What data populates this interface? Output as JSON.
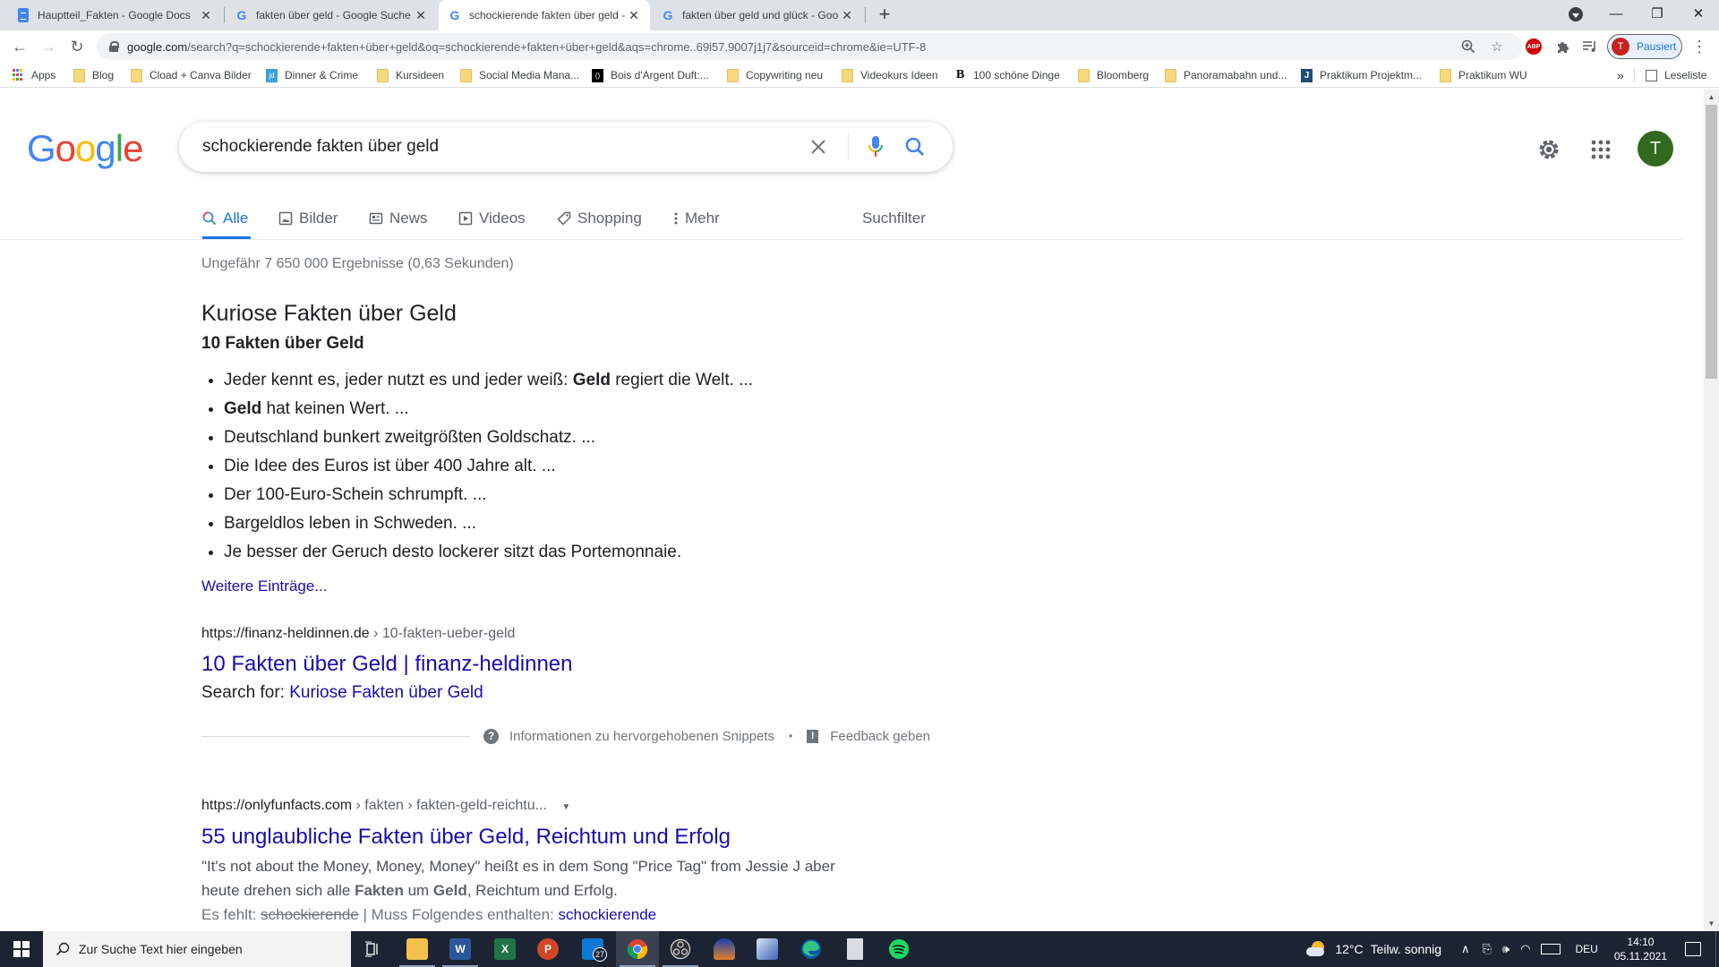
{
  "browser": {
    "tabs": [
      {
        "title": "Hauptteil_Fakten - Google Docs",
        "favicon": "google-docs-icon",
        "active": false
      },
      {
        "title": "fakten über geld - Google Suche",
        "favicon": "google-g-icon",
        "active": false
      },
      {
        "title": "schockierende fakten über geld -",
        "favicon": "google-g-icon",
        "active": true
      },
      {
        "title": "fakten über geld und glück - Goo",
        "favicon": "google-g-icon",
        "active": false
      }
    ],
    "new_tab_label": "+",
    "close_tab_glyph": "✕",
    "window_controls": {
      "minimize": "—",
      "restore": "❐",
      "close": "✕"
    },
    "address": {
      "host": "google.com",
      "path": "/search?q=schockierende+fakten+über+geld&oq=schockierende+fakten+über+geld&aqs=chrome..69i57.9007j1j7&sourceid=chrome&ie=UTF-8"
    },
    "profile": {
      "initial": "T",
      "label": "Pausiert"
    },
    "extensions": {
      "abp_label": "ABP"
    },
    "bookmarks": [
      {
        "label": "Apps",
        "icon": "apps-grid-icon"
      },
      {
        "label": "Blog",
        "icon": "folder-icon"
      },
      {
        "label": "Cload + Canva Bilder",
        "icon": "folder-icon"
      },
      {
        "label": "Dinner & Crime",
        "icon": "jd-site-icon"
      },
      {
        "label": "Kursideen",
        "icon": "folder-icon"
      },
      {
        "label": "Social Media Mana...",
        "icon": "folder-icon"
      },
      {
        "label": "Bois d'Argent Duft:...",
        "icon": "bois-site-icon"
      },
      {
        "label": "Copywriting neu",
        "icon": "folder-icon"
      },
      {
        "label": "Videokurs Ideen",
        "icon": "folder-icon"
      },
      {
        "label": "100 schöne Dinge",
        "icon": "b-site-icon"
      },
      {
        "label": "Bloomberg",
        "icon": "folder-icon"
      },
      {
        "label": "Panoramabahn und...",
        "icon": "folder-icon"
      },
      {
        "label": "Praktikum Projektm...",
        "icon": "j-site-icon"
      },
      {
        "label": "Praktikum WU",
        "icon": "folder-icon"
      }
    ],
    "bookmarks_overflow": "»",
    "reading_list_label": "Leseliste"
  },
  "google": {
    "logo_letters": [
      "G",
      "o",
      "o",
      "g",
      "l",
      "e"
    ],
    "logo_colors": [
      "#4285f4",
      "#ea4335",
      "#fbbc05",
      "#4285f4",
      "#34a853",
      "#ea4335"
    ],
    "query": "schockierende fakten über geld",
    "avatar_initial": "T",
    "nav_tabs": [
      {
        "label": "Alle",
        "icon": "search-icon",
        "active": true
      },
      {
        "label": "Bilder",
        "icon": "image-icon",
        "active": false
      },
      {
        "label": "News",
        "icon": "news-icon",
        "active": false
      },
      {
        "label": "Videos",
        "icon": "video-icon",
        "active": false
      },
      {
        "label": "Shopping",
        "icon": "tag-icon",
        "active": false
      },
      {
        "label": "Mehr",
        "icon": "more-vert-icon",
        "active": false
      }
    ],
    "search_tools_label": "Suchfilter",
    "result_stats": "Ungefähr 7 650 000 Ergebnisse (0,63 Sekunden)",
    "featured_snippet": {
      "title": "Kuriose Fakten über Geld",
      "subtitle": "10 Fakten über Geld",
      "items": [
        {
          "pre": "Jeder kennt es, jeder nutzt es und jeder weiß: ",
          "bold": "Geld",
          "post": " regiert die Welt. ..."
        },
        {
          "pre": "",
          "bold": "Geld",
          "post": " hat keinen Wert. ..."
        },
        {
          "pre": "Deutschland bunkert zweitgrößten Goldschatz. ...",
          "bold": "",
          "post": ""
        },
        {
          "pre": "Die Idee des Euros ist über 400 Jahre alt. ...",
          "bold": "",
          "post": ""
        },
        {
          "pre": "Der 100-Euro-Schein schrumpft. ...",
          "bold": "",
          "post": ""
        },
        {
          "pre": "Bargeldlos leben in Schweden. ...",
          "bold": "",
          "post": ""
        },
        {
          "pre": "Je besser der Geruch desto lockerer sitzt das Portemonnaie.",
          "bold": "",
          "post": ""
        }
      ],
      "more_label": "Weitere Einträge...",
      "cite_host": "https://finanz-heldinnen.de",
      "cite_path": " › 10-fakten-ueber-geld",
      "link_title": "10 Fakten über Geld | finanz-heldinnen",
      "search_for_prefix": "Search for: ",
      "search_for_link": "Kuriose Fakten über Geld",
      "info_label": "Informationen zu hervorgehobenen Snippets",
      "dot": "•",
      "feedback_label": "Feedback geben"
    },
    "results": [
      {
        "cite_host": "https://onlyfunfacts.com",
        "cite_path": " › fakten › fakten-geld-reichtu...",
        "title": "55 unglaubliche Fakten über Geld, Reichtum und Erfolg",
        "snippet_line1": "\"It's not about the Money, Money, Money\" heißt es in dem Song \"Price Tag\" from Jessie J aber",
        "snippet_line2_pre": "heute drehen sich alle ",
        "snippet_line2_b1": "Fakten",
        "snippet_line2_mid": " um ",
        "snippet_line2_b2": "Geld",
        "snippet_line2_post": ", Reichtum und Erfolg.",
        "missing_prefix": "Es fehlt: ",
        "missing_term": "schockierende",
        "must_include_prefix": " | Muss Folgendes enthalten: ",
        "must_include_term": "schockierende"
      }
    ]
  },
  "taskbar": {
    "search_placeholder": "Zur Suche Text hier eingeben",
    "apps": [
      {
        "name": "task-view",
        "label": ""
      },
      {
        "name": "file-explorer",
        "label": ""
      },
      {
        "name": "word",
        "label": "W"
      },
      {
        "name": "excel",
        "label": "X"
      },
      {
        "name": "powerpoint",
        "label": "P"
      },
      {
        "name": "mail",
        "label": "27"
      },
      {
        "name": "chrome",
        "label": ""
      },
      {
        "name": "obs",
        "label": ""
      },
      {
        "name": "app-blue",
        "label": ""
      },
      {
        "name": "app-image",
        "label": ""
      },
      {
        "name": "edge",
        "label": ""
      },
      {
        "name": "app-doc",
        "label": ""
      },
      {
        "name": "spotify",
        "label": ""
      }
    ],
    "weather": {
      "temp": "12°C",
      "desc": "Teilw. sonnig"
    },
    "language": "DEU",
    "time": "14:10",
    "date": "05.11.2021"
  }
}
